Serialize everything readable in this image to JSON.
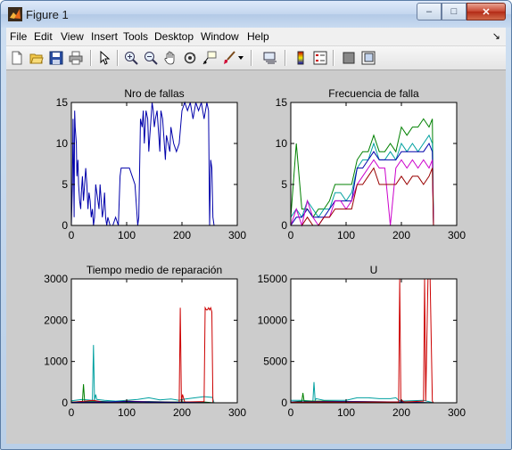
{
  "window": {
    "title": "Figure 1",
    "controls": {
      "minimize": "–",
      "maximize": "□",
      "close": "✕"
    }
  },
  "menubar": {
    "items": [
      "File",
      "Edit",
      "View",
      "Insert",
      "Tools",
      "Desktop",
      "Window",
      "Help"
    ],
    "dock_arrow": "↘"
  },
  "toolbar": {
    "buttons": [
      {
        "name": "new-figure",
        "icon": "new-document-icon"
      },
      {
        "name": "open-file",
        "icon": "folder-open-icon"
      },
      {
        "name": "save-figure",
        "icon": "save-disk-icon"
      },
      {
        "name": "print-figure",
        "icon": "printer-icon"
      },
      {
        "name": "edit-plot",
        "icon": "cursor-arrow-icon"
      },
      {
        "name": "zoom-in",
        "icon": "zoom-in-icon"
      },
      {
        "name": "zoom-out",
        "icon": "zoom-out-icon"
      },
      {
        "name": "pan",
        "icon": "hand-icon"
      },
      {
        "name": "rotate-3d",
        "icon": "rotate-icon"
      },
      {
        "name": "data-cursor",
        "icon": "data-cursor-icon"
      },
      {
        "name": "brush",
        "icon": "brush-icon"
      },
      {
        "name": "link-plot",
        "icon": "link-icon"
      },
      {
        "name": "insert-colorbar",
        "icon": "colorbar-icon"
      },
      {
        "name": "insert-legend",
        "icon": "legend-icon"
      },
      {
        "name": "hide-plot-tools",
        "icon": "hide-tools-icon"
      },
      {
        "name": "show-plot-tools",
        "icon": "show-tools-icon"
      }
    ]
  },
  "colors": {
    "blue": "#0000aa",
    "green": "#008000",
    "red": "#cc0000",
    "cyan": "#00a0a0",
    "magenta": "#cc00cc",
    "darkred": "#990000"
  },
  "chart_data": [
    {
      "type": "line",
      "title": "Nro de fallas",
      "xlim": [
        0,
        300
      ],
      "ylim": [
        0,
        15
      ],
      "xticks": [
        "0",
        "100",
        "200",
        "300"
      ],
      "yticks": [
        "0",
        "5",
        "10",
        "15"
      ],
      "series": [
        {
          "color": "#0000aa",
          "x": [
            0,
            2,
            3,
            5,
            6,
            7,
            9,
            10,
            12,
            13,
            15,
            17,
            18,
            20,
            22,
            24,
            26,
            28,
            30,
            32,
            34,
            36,
            38,
            40,
            42,
            44,
            46,
            48,
            50,
            52,
            54,
            56,
            58,
            60,
            62,
            64,
            66,
            70,
            75,
            80,
            85,
            88,
            90,
            95,
            100,
            105,
            110,
            115,
            118,
            120,
            122,
            125,
            128,
            130,
            132,
            135,
            138,
            140,
            142,
            144,
            146,
            148,
            150,
            152,
            155,
            158,
            160,
            162,
            165,
            168,
            170,
            172,
            175,
            178,
            180,
            185,
            190,
            195,
            200,
            205,
            210,
            215,
            220,
            225,
            230,
            235,
            240,
            245,
            248,
            250,
            252,
            254,
            256,
            258
          ],
          "y": [
            0,
            5,
            13,
            1,
            14,
            12,
            10,
            6,
            8,
            5,
            3,
            2,
            4,
            6,
            3,
            5,
            7,
            5,
            2,
            4,
            3,
            1,
            2,
            0,
            1,
            5,
            4,
            3,
            2,
            5,
            3,
            1,
            2,
            4,
            1,
            0,
            1,
            0,
            0,
            1,
            0,
            6,
            7,
            7,
            7,
            7,
            6,
            5,
            2,
            0,
            1,
            13,
            12,
            14,
            10,
            14,
            13,
            9,
            11,
            13,
            15,
            14,
            12,
            13,
            14,
            11,
            9,
            14,
            13,
            10,
            8,
            11,
            10,
            9,
            12,
            10,
            9,
            10,
            14,
            15,
            14,
            15,
            13,
            15,
            14,
            15,
            13,
            15,
            14,
            0,
            8,
            7,
            1,
            0
          ]
        }
      ]
    },
    {
      "type": "line",
      "title": "Frecuencia de falla",
      "xlim": [
        0,
        300
      ],
      "ylim": [
        0,
        15
      ],
      "xticks": [
        "0",
        "100",
        "200",
        "300"
      ],
      "yticks": [
        "0",
        "5",
        "10",
        "15"
      ],
      "series": [
        {
          "color": "#008000",
          "x": [
            0,
            10,
            20,
            30,
            40,
            50,
            60,
            70,
            80,
            90,
            100,
            110,
            120,
            130,
            140,
            150,
            160,
            170,
            180,
            190,
            200,
            210,
            220,
            230,
            240,
            250,
            256,
            258
          ],
          "y": [
            1,
            10,
            2,
            2,
            1,
            2,
            2,
            3,
            5,
            5,
            5,
            5,
            8,
            9,
            9,
            11,
            9,
            9,
            10,
            9,
            12,
            11,
            12,
            12,
            13,
            12,
            13,
            0
          ]
        },
        {
          "color": "#00a0a0",
          "x": [
            0,
            10,
            20,
            30,
            40,
            50,
            60,
            70,
            80,
            90,
            100,
            110,
            120,
            130,
            140,
            150,
            160,
            170,
            180,
            190,
            200,
            210,
            220,
            230,
            240,
            250,
            256,
            258
          ],
          "y": [
            1,
            2,
            1,
            3,
            2,
            1,
            2,
            2,
            4,
            4,
            3,
            4,
            7,
            8,
            8,
            10,
            8,
            8,
            9,
            8,
            10,
            9,
            10,
            9,
            10,
            11,
            10,
            0
          ]
        },
        {
          "color": "#0000aa",
          "x": [
            0,
            10,
            20,
            30,
            40,
            50,
            60,
            70,
            80,
            90,
            100,
            110,
            120,
            130,
            140,
            150,
            160,
            170,
            180,
            190,
            200,
            210,
            220,
            230,
            240,
            250,
            256,
            258
          ],
          "y": [
            0,
            1,
            1,
            2,
            1,
            1,
            1,
            2,
            3,
            3,
            3,
            3,
            7,
            7,
            8,
            9,
            8,
            8,
            8,
            8,
            9,
            9,
            9,
            9,
            9,
            10,
            9,
            0
          ]
        },
        {
          "color": "#cc00cc",
          "x": [
            0,
            10,
            20,
            30,
            40,
            50,
            60,
            70,
            80,
            90,
            100,
            110,
            120,
            130,
            140,
            150,
            160,
            170,
            180,
            190,
            200,
            210,
            220,
            230,
            240,
            250,
            256,
            258
          ],
          "y": [
            0,
            2,
            0,
            3,
            1,
            0,
            1,
            1,
            3,
            3,
            2,
            3,
            5,
            6,
            7,
            8,
            7,
            7,
            0,
            7,
            8,
            7,
            8,
            7,
            8,
            7,
            8,
            0
          ]
        },
        {
          "color": "#990000",
          "x": [
            0,
            10,
            20,
            30,
            40,
            50,
            60,
            70,
            80,
            90,
            100,
            110,
            120,
            130,
            140,
            150,
            160,
            170,
            180,
            190,
            200,
            210,
            220,
            230,
            240,
            250,
            256,
            258
          ],
          "y": [
            0,
            0,
            0,
            1,
            0,
            0,
            1,
            1,
            2,
            2,
            2,
            2,
            5,
            5,
            6,
            7,
            5,
            5,
            5,
            5,
            6,
            5,
            6,
            6,
            5,
            6,
            7,
            0
          ]
        }
      ]
    },
    {
      "type": "line",
      "title": "Tiempo medio de reparación",
      "xlim": [
        0,
        300
      ],
      "ylim": [
        0,
        3000
      ],
      "xticks": [
        "0",
        "100",
        "200",
        "300"
      ],
      "yticks": [
        "0",
        "1000",
        "2000",
        "3000"
      ],
      "series": [
        {
          "color": "#00a0a0",
          "x": [
            0,
            20,
            38,
            40,
            42,
            44,
            46,
            60,
            80,
            100,
            120,
            140,
            160,
            180,
            195,
            200,
            240,
            255,
            258
          ],
          "y": [
            50,
            80,
            60,
            1400,
            60,
            200,
            80,
            60,
            40,
            60,
            80,
            120,
            70,
            90,
            60,
            80,
            150,
            130,
            0
          ]
        },
        {
          "color": "#008000",
          "x": [
            0,
            20,
            22,
            24,
            40,
            60,
            80,
            100,
            140,
            180,
            200,
            240,
            258
          ],
          "y": [
            20,
            30,
            450,
            30,
            40,
            30,
            20,
            20,
            30,
            20,
            20,
            20,
            0
          ]
        },
        {
          "color": "#cc0000",
          "x": [
            0,
            40,
            60,
            80,
            100,
            150,
            195,
            197,
            199,
            201,
            205,
            240,
            242,
            244,
            246,
            248,
            250,
            252,
            254,
            256
          ],
          "y": [
            10,
            60,
            10,
            20,
            40,
            20,
            10,
            2300,
            20,
            200,
            20,
            30,
            2300,
            2250,
            2250,
            2300,
            2250,
            2300,
            2200,
            0
          ]
        },
        {
          "color": "#0000aa",
          "x": [
            0,
            50,
            100,
            150,
            200,
            258
          ],
          "y": [
            10,
            20,
            30,
            20,
            10,
            0
          ]
        }
      ]
    },
    {
      "type": "line",
      "title": "U",
      "xlim": [
        0,
        300
      ],
      "ylim": [
        0,
        15000
      ],
      "xticks": [
        "0",
        "100",
        "200",
        "300"
      ],
      "yticks": [
        "0",
        "5000",
        "10000",
        "15000"
      ],
      "series": [
        {
          "color": "#00a0a0",
          "x": [
            0,
            20,
            40,
            42,
            44,
            46,
            60,
            100,
            120,
            140,
            160,
            180,
            190,
            195,
            200,
            240,
            258
          ],
          "y": [
            300,
            300,
            200,
            2500,
            300,
            500,
            300,
            300,
            600,
            600,
            500,
            500,
            600,
            300,
            200,
            300,
            0
          ]
        },
        {
          "color": "#008000",
          "x": [
            0,
            20,
            22,
            24,
            60,
            100,
            200,
            258
          ],
          "y": [
            100,
            200,
            1200,
            200,
            200,
            150,
            100,
            0
          ]
        },
        {
          "color": "#0000aa",
          "x": [
            0,
            60,
            120,
            200,
            258
          ],
          "y": [
            100,
            150,
            150,
            100,
            0
          ]
        },
        {
          "color": "#cc0000",
          "x": [
            0,
            60,
            100,
            150,
            195,
            197,
            199,
            201,
            205,
            240,
            242,
            244,
            248,
            252,
            256,
            258
          ],
          "y": [
            50,
            100,
            80,
            100,
            100,
            15000,
            200,
            300,
            100,
            200,
            15000,
            200,
            15000,
            15000,
            200,
            0
          ]
        }
      ]
    }
  ]
}
